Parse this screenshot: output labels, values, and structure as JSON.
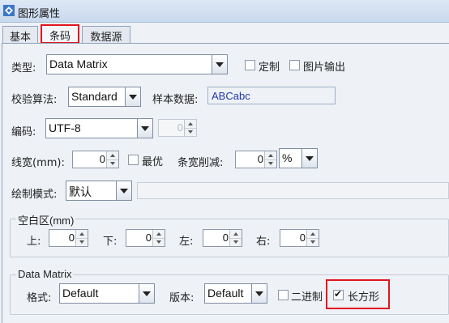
{
  "window": {
    "title": "图形属性",
    "icon": "diamond-app-icon"
  },
  "tabs": [
    {
      "label": "基本",
      "active": false
    },
    {
      "label": "条码",
      "active": true
    },
    {
      "label": "数据源",
      "active": false
    }
  ],
  "type_row": {
    "label": "类型:",
    "value": "Data Matrix",
    "custom_label": "定制",
    "custom_checked": false,
    "image_output_label": "图片输出",
    "image_output_checked": false
  },
  "check_row": {
    "label": "校验算法:",
    "value": "Standard",
    "sample_label": "样本数据:",
    "sample_value": "ABCabc"
  },
  "encoding_row": {
    "label": "编码:",
    "value": "UTF-8",
    "spin_value": "0"
  },
  "line_row": {
    "label": "线宽(mm):",
    "width_value": "0",
    "optimal_label": "最优",
    "optimal_checked": false,
    "reduce_label": "条宽削减:",
    "reduce_value": "0",
    "unit_value": "%"
  },
  "draw_row": {
    "label": "绘制模式:",
    "value": "默认"
  },
  "quiet_zone": {
    "title": "空白区(mm)",
    "top_label": "上:",
    "top_value": "0",
    "bottom_label": "下:",
    "bottom_value": "0",
    "left_label": "左:",
    "left_value": "0",
    "right_label": "右:",
    "right_value": "0"
  },
  "datamatrix": {
    "title": "Data Matrix",
    "format_label": "格式:",
    "format_value": "Default",
    "version_label": "版本:",
    "version_value": "Default",
    "binary_label": "二进制",
    "binary_checked": false,
    "rect_label": "长方形",
    "rect_checked": true
  },
  "colors": {
    "highlight": "#e2141c",
    "sample_text": "#1f3aa8"
  }
}
